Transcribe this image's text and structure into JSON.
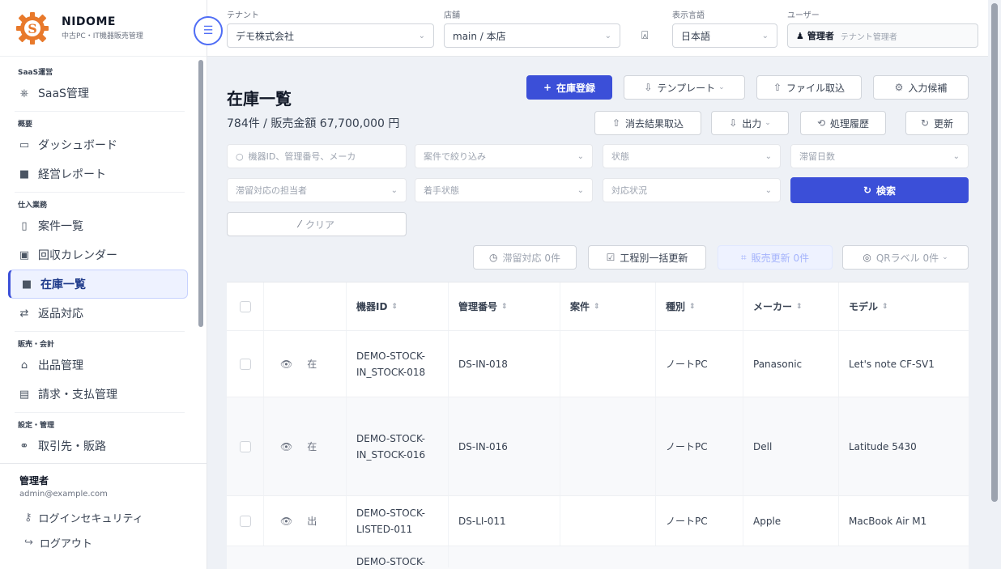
{
  "brand": {
    "name": "NIDOME",
    "subtitle": "中古PC・IT機器販売管理"
  },
  "sidebar": {
    "sections": [
      {
        "title": "SaaS運営",
        "items": [
          {
            "label": "SaaS管理",
            "icon": "ship-wheel-icon"
          }
        ]
      },
      {
        "title": "概要",
        "items": [
          {
            "label": "ダッシュボード",
            "icon": "monitor-icon"
          },
          {
            "label": "経営レポート",
            "icon": "report-icon"
          }
        ]
      },
      {
        "title": "仕入業務",
        "items": [
          {
            "label": "案件一覧",
            "icon": "file-icon"
          },
          {
            "label": "回収カレンダー",
            "icon": "calendar-icon"
          },
          {
            "label": "在庫一覧",
            "icon": "box-icon",
            "active": true
          },
          {
            "label": "返品対応",
            "icon": "return-icon"
          }
        ]
      },
      {
        "title": "販売・会計",
        "items": [
          {
            "label": "出品管理",
            "icon": "bag-icon"
          },
          {
            "label": "請求・支払管理",
            "icon": "invoice-icon"
          }
        ]
      },
      {
        "title": "設定・管理",
        "items": [
          {
            "label": "取引先・販路",
            "icon": "handshake-icon"
          }
        ]
      }
    ]
  },
  "user": {
    "name": "管理者",
    "email": "admin@example.com",
    "security_label": "ログインセキュリティ",
    "logout_label": "ログアウト"
  },
  "topbar": {
    "tenant_label": "テナント",
    "tenant_value": "デモ株式会社",
    "store_label": "店舗",
    "store_value": "main / 本店",
    "language_label": "表示言語",
    "language_value": "日本語",
    "user_label": "ユーザー",
    "user_role": "管理者",
    "user_sub": "テナント管理者"
  },
  "page": {
    "title": "在庫一覧",
    "summary": "784件 / 販売金額 67,700,000 円",
    "buttons": {
      "register": "在庫登録",
      "template": "テンプレート",
      "file_import": "ファイル取込",
      "input_history": "入力候補",
      "erase_import": "消去結果取込",
      "export": "出力",
      "process_history": "処理履歴",
      "refresh": "更新",
      "search": "検索",
      "clear": "クリア",
      "pending": "滞留対応 0件",
      "bulk_update": "工程別一括更新",
      "sales_update": "販売更新 0件",
      "qr_label": "QRラベル 0件"
    },
    "filters": {
      "keyword_placeholder": "機器ID、管理番号、メーカ",
      "case_placeholder": "案件で絞り込み",
      "status_placeholder": "状態",
      "days_placeholder": "滞留日数",
      "assignee_placeholder": "滞留対応の担当者",
      "receive_placeholder": "着手状態",
      "response_placeholder": "対応状況"
    }
  },
  "table": {
    "columns": [
      "機器ID",
      "管理番号",
      "案件",
      "種別",
      "メーカー",
      "モデル"
    ],
    "rows": [
      {
        "device_id": "DEMO-STOCK-IN_STOCK-018",
        "device_id_l1": "DEMO-STOCK-",
        "device_id_l2": "IN_STOCK-018",
        "mgmt_no": "DS-IN-018",
        "case": "",
        "type": "ノートPC",
        "maker": "Panasonic",
        "model": "Let's note CF-SV1",
        "badge": "在"
      },
      {
        "device_id": "DEMO-STOCK-IN_STOCK-016",
        "device_id_l1": "DEMO-STOCK-",
        "device_id_l2": "IN_STOCK-016",
        "mgmt_no": "DS-IN-016",
        "case": "",
        "type": "ノートPC",
        "maker": "Dell",
        "model": "Latitude 5430",
        "badge": "在"
      },
      {
        "device_id": "DEMO-STOCK-LISTED-011",
        "device_id_l1": "DEMO-STOCK-",
        "device_id_l2": "LISTED-011",
        "mgmt_no": "DS-LI-011",
        "case": "",
        "type": "ノートPC",
        "maker": "Apple",
        "model": "MacBook Air M1",
        "badge": "出"
      },
      {
        "device_id_l1": "DEMO-STOCK-",
        "device_id_l2": "",
        "mgmt_no": "",
        "case": "",
        "type": "",
        "maker": "",
        "model": "",
        "badge": ""
      }
    ]
  }
}
